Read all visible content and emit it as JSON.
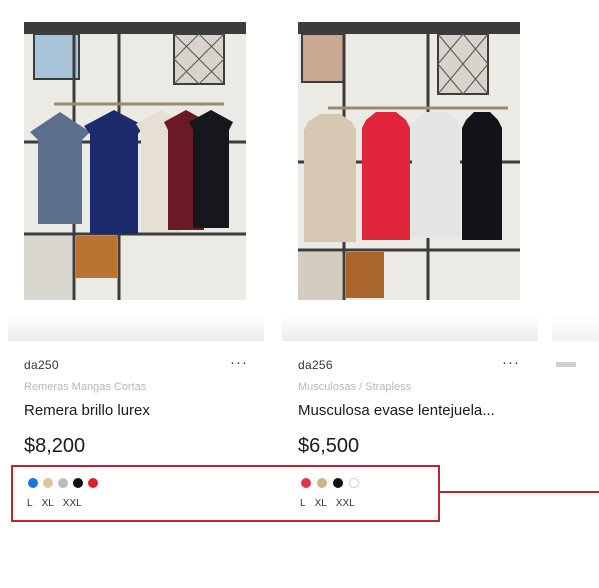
{
  "products": [
    {
      "sku": "da250",
      "category": "Remeras Mangas Cortas",
      "name": "Remera brillo lurex",
      "price": "$8,200",
      "more_label": "···",
      "colors": [
        "#1a73e8",
        "#dcc59c",
        "#bdbdbd",
        "#111111",
        "#d9232e"
      ],
      "sizes": [
        "L",
        "XL",
        "XXL"
      ]
    },
    {
      "sku": "da256",
      "category": "Musculosas / Strapless",
      "name": "Musculosa evase lentejuela...",
      "price": "$6,500",
      "more_label": "···",
      "colors": [
        "#e0374a",
        "#d2b48a",
        "#111111",
        "#ffffff"
      ],
      "sizes": [
        "L",
        "XL",
        "XXL"
      ]
    }
  ],
  "annotation": {
    "color": "#c0262d"
  }
}
